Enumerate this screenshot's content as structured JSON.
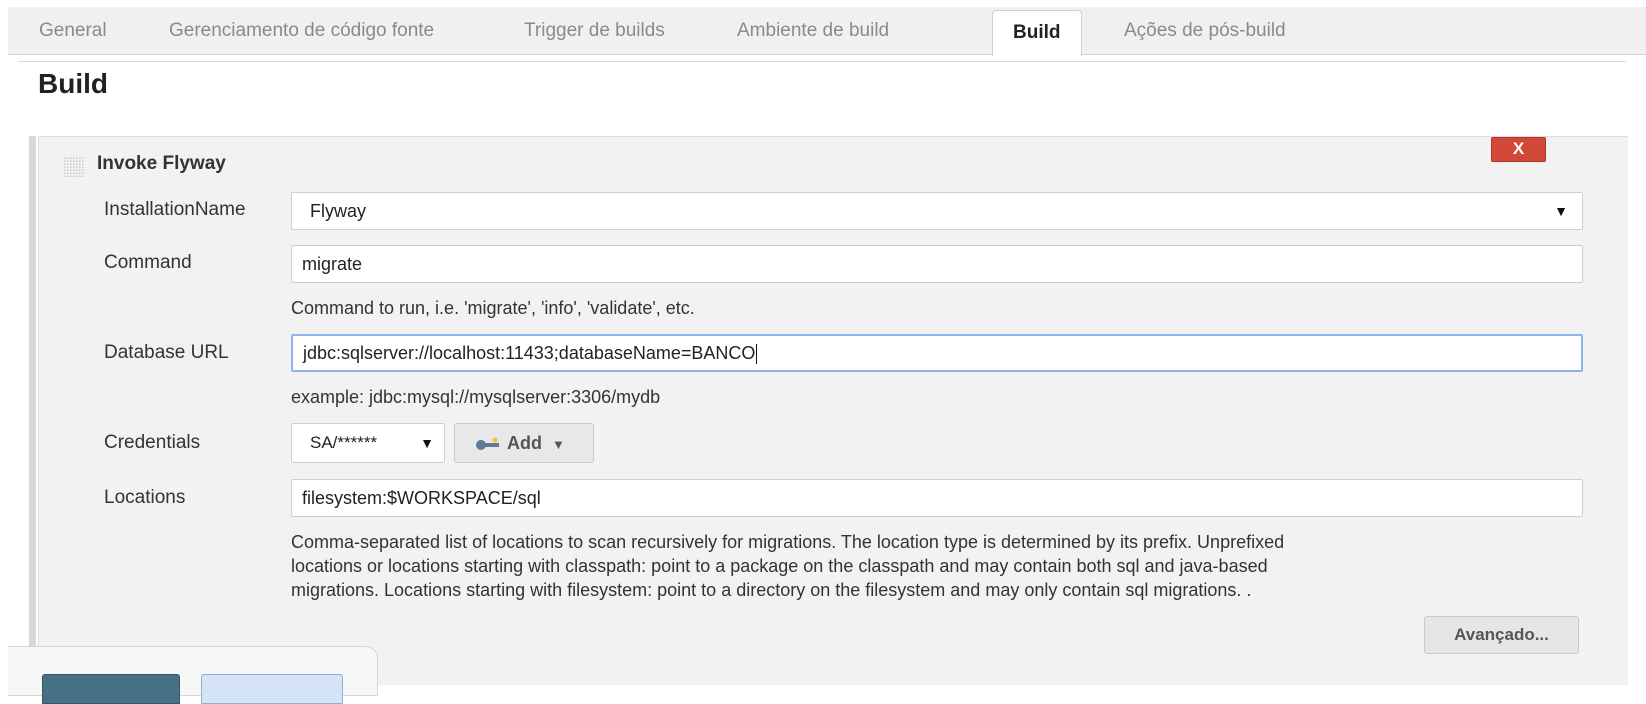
{
  "tabs": [
    {
      "label": "General"
    },
    {
      "label": "Gerenciamento de código fonte"
    },
    {
      "label": "Trigger de builds"
    },
    {
      "label": "Ambiente de build"
    },
    {
      "label": "Build"
    },
    {
      "label": "Ações de pós-build"
    }
  ],
  "active_tab": "Build",
  "section": {
    "title": "Build"
  },
  "step": {
    "title": "Invoke Flyway",
    "delete_label": "X",
    "installation": {
      "label": "InstallationName",
      "value": "Flyway"
    },
    "command": {
      "label": "Command",
      "value": "migrate",
      "help": "Command to run, i.e. 'migrate', 'info', 'validate', etc."
    },
    "database_url": {
      "label": "Database URL",
      "value": "jdbc:sqlserver://localhost:11433;databaseName=BANCO",
      "help": "example: jdbc:mysql://mysqlserver:3306/mydb"
    },
    "credentials": {
      "label": "Credentials",
      "value": "SA/******",
      "add_label": "Add"
    },
    "locations": {
      "label": "Locations",
      "value": "filesystem:$WORKSPACE/sql",
      "help": [
        "Comma-separated list of locations to scan recursively for migrations. The location type is determined by its prefix. Unprefixed",
        "locations or locations starting with classpath: point to a package on the classpath and may contain both sql and java-based",
        "migrations. Locations starting with filesystem: point to a directory on the filesystem and may only contain sql migrations. ."
      ]
    },
    "advanced_label": "Avançado..."
  },
  "colors": {
    "accent": "#d24939",
    "focus": "#8cb4ee",
    "save": "#467083",
    "apply": "#d4e3f6"
  },
  "icons": {
    "credentials_add": "key-icon",
    "drag": "grip-icon"
  }
}
